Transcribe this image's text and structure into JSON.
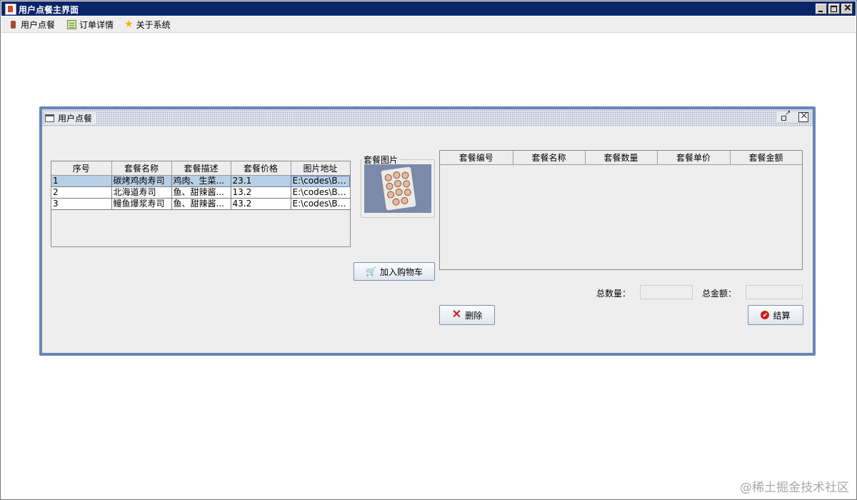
{
  "window": {
    "title": "用户点餐主界面"
  },
  "menubar": {
    "items": [
      "用户点餐",
      "订单详情",
      "关于系统"
    ]
  },
  "internal_frame": {
    "title": "用户点餐"
  },
  "menu_table": {
    "columns": [
      "序号",
      "套餐名称",
      "套餐描述",
      "套餐价格",
      "图片地址"
    ],
    "rows": [
      [
        "1",
        "碳烤鸡肉寿司",
        "鸡肉、生菜...",
        "23.1",
        "E:\\codes\\Bu..."
      ],
      [
        "2",
        "北海道寿司",
        "鱼、甜辣酱...",
        "13.2",
        "E:\\codes\\Bu..."
      ],
      [
        "3",
        "鳗鱼爆浆寿司",
        "鱼、甜辣酱...",
        "43.2",
        "E:\\codes\\Bu..."
      ]
    ],
    "selected_row": 1
  },
  "image_panel": {
    "label": "套餐图片"
  },
  "buttons": {
    "add_to_cart": "加入购物车",
    "delete": "删除",
    "checkout": "结算"
  },
  "cart_table": {
    "columns": [
      "套餐编号",
      "套餐名称",
      "套餐数量",
      "套餐单价",
      "套餐金额"
    ],
    "rows": []
  },
  "totals": {
    "count_label": "总数量：",
    "count_value": "",
    "amount_label": "总金额：",
    "amount_value": ""
  },
  "watermark": "@稀土掘金技术社区"
}
